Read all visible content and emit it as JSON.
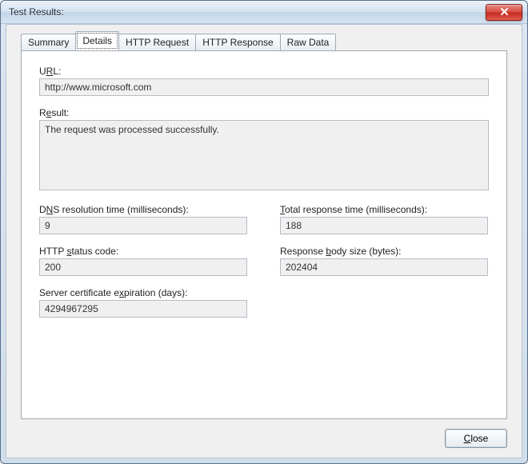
{
  "window": {
    "title": "Test Results:"
  },
  "tabs": {
    "summary": "Summary",
    "details": "Details",
    "http_request": "HTTP Request",
    "http_response": "HTTP Response",
    "raw_data": "Raw Data"
  },
  "fields": {
    "url": {
      "label_prefix": "U",
      "label_underlined": "R",
      "label_suffix": "L:",
      "value": "http://www.microsoft.com"
    },
    "result": {
      "label_prefix": "R",
      "label_underlined": "e",
      "label_suffix": "sult:",
      "value": "The request was processed successfully."
    },
    "dns": {
      "label_prefix": "D",
      "label_underlined": "N",
      "label_suffix": "S resolution time (milliseconds):",
      "value": "9"
    },
    "total_response": {
      "label_underlined": "T",
      "label_suffix": "otal response time (milliseconds):",
      "value": "188"
    },
    "status_code": {
      "label_prefix": "HTTP ",
      "label_underlined": "s",
      "label_suffix": "tatus code:",
      "value": "200"
    },
    "body_size": {
      "label_prefix": "Response ",
      "label_underlined": "b",
      "label_suffix": "ody size (bytes):",
      "value": "202404"
    },
    "cert_exp": {
      "label_prefix": "Server certificate e",
      "label_underlined": "x",
      "label_suffix": "piration (days):",
      "value": "4294967295"
    }
  },
  "buttons": {
    "close_underlined": "C",
    "close_suffix": "lose"
  }
}
